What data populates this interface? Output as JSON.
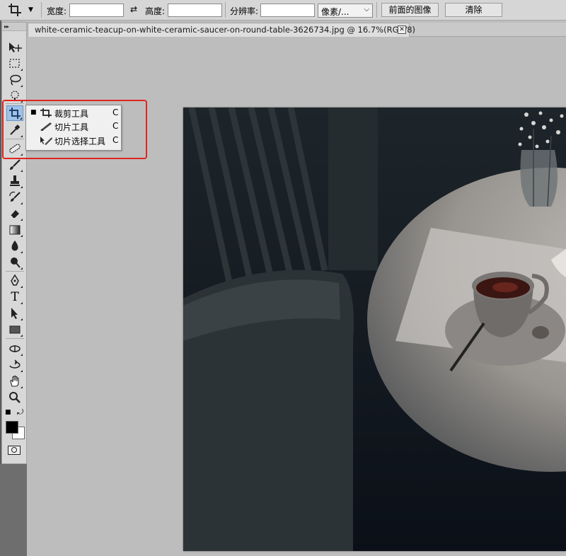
{
  "options_bar": {
    "width_label": "宽度:",
    "width_value": "",
    "swap_icon": "swap-arrows-icon",
    "height_label": "高度:",
    "height_value": "",
    "resolution_label": "分辨率:",
    "resolution_value": "",
    "unit_select": "像素/...",
    "front_image_button": "前面的图像",
    "clear_button": "清除"
  },
  "document": {
    "tab_title": "white-ceramic-teacup-on-white-ceramic-saucer-on-round-table-3626734.jpg @ 16.7%(RGB/8)",
    "close_glyph": "✕"
  },
  "toolbar": {
    "grip_glyph": "▸▸",
    "tools": [
      {
        "name": "move-tool",
        "icon": "move-icon"
      },
      {
        "name": "marquee-tool",
        "icon": "marquee-icon"
      },
      {
        "name": "lasso-tool",
        "icon": "lasso-icon"
      },
      {
        "name": "quick-select-tool",
        "icon": "quick-select-icon"
      },
      {
        "name": "crop-tool",
        "icon": "crop-icon",
        "active": true
      },
      {
        "name": "eyedropper-tool",
        "icon": "eyedropper-icon"
      },
      {
        "name": "healing-brush-tool",
        "icon": "bandage-icon"
      },
      {
        "name": "brush-tool",
        "icon": "brush-icon"
      },
      {
        "name": "clone-stamp-tool",
        "icon": "stamp-icon"
      },
      {
        "name": "history-brush-tool",
        "icon": "history-brush-icon"
      },
      {
        "name": "eraser-tool",
        "icon": "eraser-icon"
      },
      {
        "name": "gradient-tool",
        "icon": "gradient-icon"
      },
      {
        "name": "blur-tool",
        "icon": "drop-icon"
      },
      {
        "name": "dodge-tool",
        "icon": "dodge-icon"
      },
      {
        "name": "pen-tool",
        "icon": "pen-icon"
      },
      {
        "name": "type-tool",
        "icon": "type-icon"
      },
      {
        "name": "path-select-tool",
        "icon": "path-select-icon"
      },
      {
        "name": "rectangle-tool",
        "icon": "rectangle-icon"
      },
      {
        "name": "3d-rotate-tool",
        "icon": "3d-rotate-icon"
      },
      {
        "name": "3d-orbit-tool",
        "icon": "3d-orbit-icon"
      },
      {
        "name": "hand-tool",
        "icon": "hand-icon"
      },
      {
        "name": "zoom-tool",
        "icon": "zoom-icon"
      }
    ],
    "type_glyph": "T",
    "colors": {
      "foreground": "#000000",
      "background": "#ffffff"
    }
  },
  "flyout": {
    "items": [
      {
        "label": "裁剪工具",
        "shortcut": "C",
        "selected": true,
        "icon": "crop-icon"
      },
      {
        "label": "切片工具",
        "shortcut": "C",
        "selected": false,
        "icon": "slice-icon"
      },
      {
        "label": "切片选择工具",
        "shortcut": "C",
        "selected": false,
        "icon": "slice-select-icon"
      }
    ],
    "bullet": "■"
  },
  "colors": {
    "highlight": "#e0261f",
    "active_tool": "#9fc2e7"
  }
}
